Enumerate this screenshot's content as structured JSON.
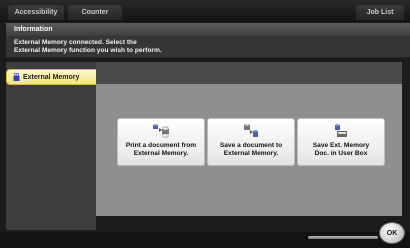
{
  "topbar": {
    "accessibility_label": "Accessibility",
    "counter_label": "Counter",
    "joblist_label": "Job List"
  },
  "info": {
    "title": "Information",
    "message_line1": "External Memory connected. Select the",
    "message_line2": "External Memory function you wish to perform."
  },
  "sidebar": {
    "items": [
      {
        "label": "External Memory",
        "icon": "usb-memory-icon",
        "selected": true
      }
    ]
  },
  "functions": [
    {
      "label": "Print a document from\nExternal Memory.",
      "icon": "print-from-memory-icon"
    },
    {
      "label": "Save a document to\nExternal Memory.",
      "icon": "save-to-memory-icon"
    },
    {
      "label": "Save Ext. Memory\nDoc. in User Box",
      "icon": "save-to-userbox-icon"
    }
  ],
  "footer": {
    "ok_label": "OK"
  },
  "colors": {
    "selected_item": "#f1e38a",
    "content_bg": "#8f8f8f",
    "header_bg": "#4a4a4a"
  }
}
